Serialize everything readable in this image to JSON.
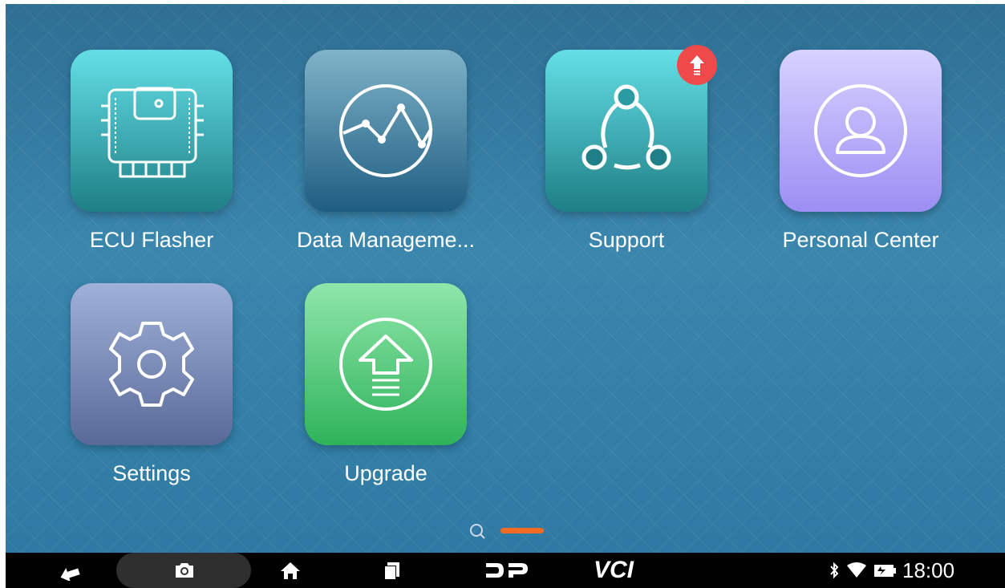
{
  "apps": [
    {
      "id": "ecu-flasher",
      "label": "ECU Flasher",
      "icon": "ecu-chip-icon",
      "colors": [
        "#64dfe6",
        "#1f7f86"
      ]
    },
    {
      "id": "data-management",
      "label": "Data Manageme...",
      "icon": "line-chart-circle-icon",
      "colors": [
        "#7fb3c8",
        "#1f5d82"
      ]
    },
    {
      "id": "support",
      "label": "Support",
      "icon": "share-network-icon",
      "colors": [
        "#64dfe6",
        "#1f7f86"
      ],
      "badge": "upgrade-badge-icon"
    },
    {
      "id": "personal-center",
      "label": "Personal Center",
      "icon": "user-circle-icon",
      "colors": [
        "#d7d2ff",
        "#9c8ef3"
      ]
    },
    {
      "id": "settings",
      "label": "Settings",
      "icon": "gear-icon",
      "colors": [
        "#9fb0d9",
        "#5a6a98"
      ]
    },
    {
      "id": "upgrade",
      "label": "Upgrade",
      "icon": "upload-arrow-icon",
      "colors": [
        "#8fe6aa",
        "#2eb35a"
      ]
    }
  ],
  "page_indicator": {
    "pages": 2,
    "active": 1,
    "accent": "#f26b22"
  },
  "navbar": {
    "buttons": [
      "back-icon",
      "screenshot-icon",
      "home-icon",
      "recents-icon",
      "dp-logo-icon"
    ],
    "vci_label": "VCI",
    "status_icons": [
      "bluetooth-icon",
      "wifi-icon",
      "battery-icon"
    ],
    "time": "18:00"
  }
}
